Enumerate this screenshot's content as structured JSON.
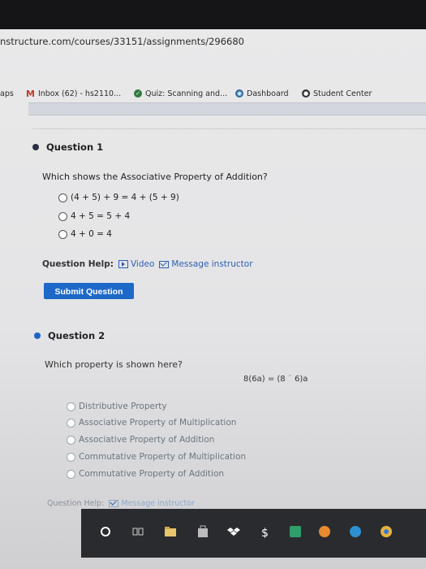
{
  "browser": {
    "url": "nstructure.com/courses/33151/assignments/296680",
    "bookmarks": [
      {
        "label": "aps"
      },
      {
        "label": "Inbox (62) - hs2110..."
      },
      {
        "label": "Quiz: Scanning and..."
      },
      {
        "label": "Dashboard"
      },
      {
        "label": "Student Center"
      }
    ]
  },
  "q1": {
    "title": "Question 1",
    "prompt": "Which shows the Associative Property of Addition?",
    "options": [
      "(4 + 5) + 9 = 4 + (5 + 9)",
      "4 + 5 = 5 + 4",
      "4 + 0 = 4"
    ],
    "help_label": "Question Help:",
    "video_label": "Video",
    "message_label": "Message instructor",
    "submit_label": "Submit Question"
  },
  "q2": {
    "title": "Question 2",
    "prompt": "Which property is shown here?",
    "formula": "8(6a) = (8 ˙ 6)a",
    "options": [
      "Distributive Property",
      "Associative Property of Multiplication",
      "Associative Property of Addition",
      "Commutative Property of Multiplication",
      "Commutative Property of Addition"
    ],
    "help_label": "Question Help:",
    "message_label": "Message instructor"
  },
  "colors": {
    "accent": "#1e68c8",
    "link": "#2d5fb3"
  },
  "taskbar_icons": [
    "cortana-circle-icon",
    "task-view-icon",
    "file-explorer-icon",
    "store-icon",
    "dropbox-icon",
    "dollar-icon",
    "app-green-icon",
    "app-orange-icon",
    "edge-icon",
    "chrome-icon"
  ]
}
